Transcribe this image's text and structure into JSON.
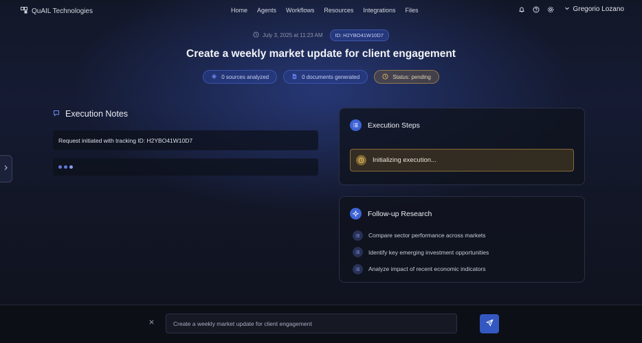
{
  "brand": {
    "name": "QuAIL Technologies"
  },
  "nav": {
    "links": [
      "Home",
      "Agents",
      "Workflows",
      "Resources",
      "Integrations",
      "Files"
    ],
    "user": "Gregorio Lozano"
  },
  "meta": {
    "date": "July 3, 2025 at 11:23 AM",
    "id": "ID: H2YBO41W10D7"
  },
  "title": "Create a weekly market update for client engagement",
  "stats": {
    "sources": "0 sources analyzed",
    "documents": "0 documents generated",
    "status": "Status: pending"
  },
  "notes": {
    "heading": "Execution Notes",
    "items": [
      "Request initiated with tracking ID: H2YBO41W10D7"
    ]
  },
  "steps": {
    "heading": "Execution Steps",
    "current": "Initializing execution..."
  },
  "followup": {
    "heading": "Follow-up Research",
    "items": [
      "Compare sector performance across markets",
      "Identify key emerging investment opportunities",
      "Analyze impact of recent economic indicators"
    ]
  },
  "prompt": {
    "value": "Create a weekly market update for client engagement"
  },
  "colors": {
    "accent": "#3e63d6",
    "pending": "#c8a050",
    "background": "#121728"
  },
  "icons": [
    "logo-icon",
    "bell-icon",
    "help-icon",
    "settings-icon",
    "chevron-down-icon",
    "clock-icon",
    "sources-icon",
    "document-icon",
    "chat-icon",
    "list-icon",
    "sparkle-icon",
    "close-icon",
    "send-icon",
    "chevron-right-icon"
  ]
}
